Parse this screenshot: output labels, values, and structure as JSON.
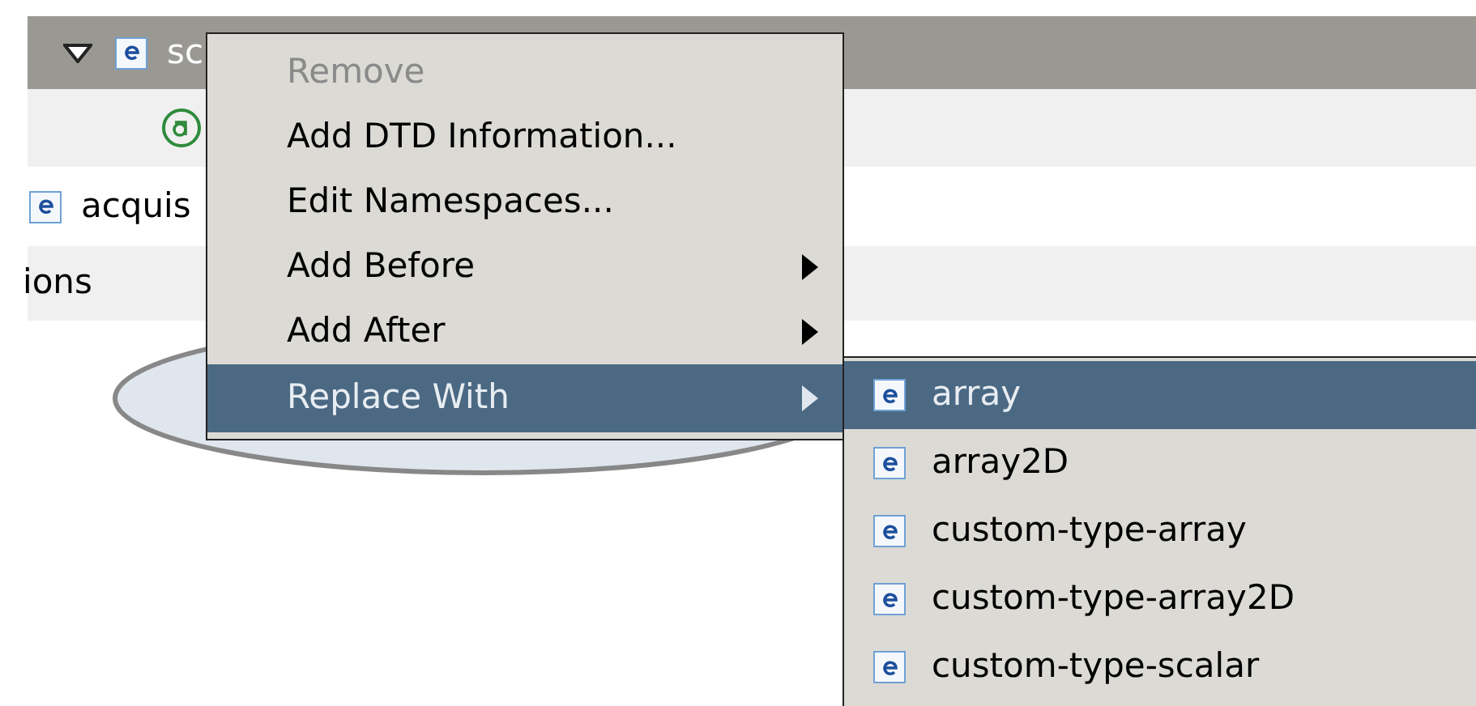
{
  "tree": {
    "rows": [
      {
        "kind": "element",
        "label": "sc",
        "expanded": true,
        "selected": true
      },
      {
        "kind": "attribute",
        "selected": false
      },
      {
        "kind": "element",
        "label": "acquis",
        "selected": false
      },
      {
        "kind": "text",
        "label": "ions",
        "selected": false
      }
    ]
  },
  "context_menu": {
    "items": [
      {
        "label": "Remove",
        "disabled": true,
        "selected": false,
        "submenu": false
      },
      {
        "label": "Add DTD Information...",
        "disabled": false,
        "selected": false,
        "submenu": false
      },
      {
        "label": "Edit Namespaces...",
        "disabled": false,
        "selected": false,
        "submenu": false
      },
      {
        "label": "Add Before",
        "disabled": false,
        "selected": false,
        "submenu": true
      },
      {
        "label": "Add After",
        "disabled": false,
        "selected": false,
        "submenu": true
      },
      {
        "label": "Replace With",
        "disabled": false,
        "selected": true,
        "submenu": true
      }
    ]
  },
  "submenu": {
    "items": [
      {
        "label": "array",
        "selected": true
      },
      {
        "label": "array2D",
        "selected": false
      },
      {
        "label": "custom-type-array",
        "selected": false
      },
      {
        "label": "custom-type-array2D",
        "selected": false
      },
      {
        "label": "custom-type-scalar",
        "selected": false
      }
    ]
  }
}
